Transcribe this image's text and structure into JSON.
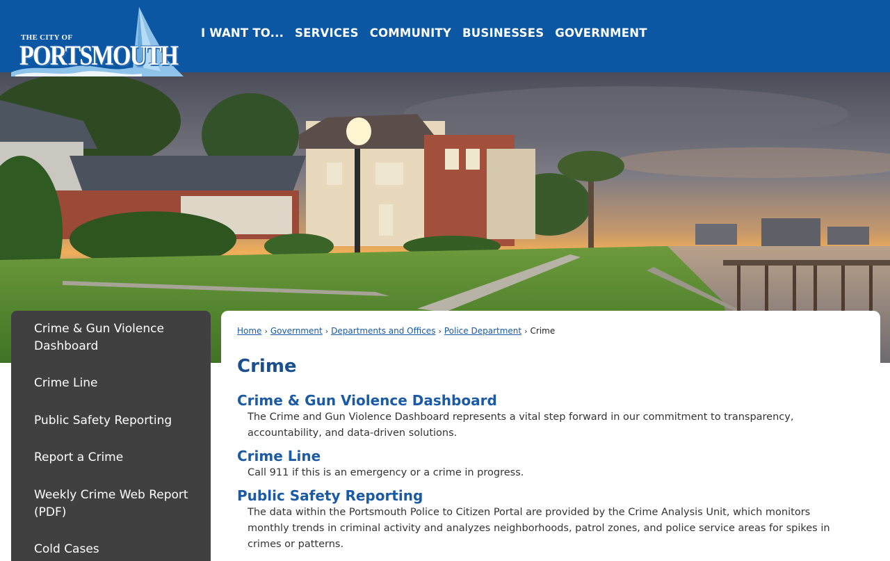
{
  "header": {
    "logo_top": "THE CITY OF",
    "logo_main": "PORTSMOUTH",
    "nav": [
      {
        "label": "I WANT TO..."
      },
      {
        "label": "SERVICES"
      },
      {
        "label": "COMMUNITY"
      },
      {
        "label": "BUSINESSES"
      },
      {
        "label": "GOVERNMENT"
      }
    ]
  },
  "sidebar": {
    "items": [
      {
        "label": "Crime & Gun Violence Dashboard"
      },
      {
        "label": "Crime Line"
      },
      {
        "label": "Public Safety Reporting"
      },
      {
        "label": "Report a Crime"
      },
      {
        "label": "Weekly Crime Web Report (PDF)"
      },
      {
        "label": "Cold Cases"
      }
    ]
  },
  "breadcrumb": {
    "items": [
      {
        "label": "Home"
      },
      {
        "label": " Government"
      },
      {
        "label": " Departments and Offices"
      },
      {
        "label": " Police Department"
      }
    ],
    "current": "Crime",
    "separator": "›"
  },
  "main": {
    "title": "Crime",
    "sections": [
      {
        "title": "Crime & Gun Violence Dashboard",
        "desc": "The Crime and Gun Violence Dashboard represents a vital step forward in our commitment to transparency, accountability, and data-driven solutions."
      },
      {
        "title": "Crime Line",
        "desc": "Call 911 if this is an emergency or a crime in progress."
      },
      {
        "title": "Public Safety Reporting",
        "desc": "The data within the Portsmouth Police to Citizen Portal are provided by the Crime Analysis Unit, which monitors monthly trends in criminal activity and analyzes neighborhoods, patrol zones, and police service areas for spikes in crimes or patterns."
      }
    ]
  },
  "colors": {
    "header_bg": "#0b57a4",
    "sidebar_bg": "#404040",
    "link": "#1a5aa3",
    "heading": "#1b4f8c"
  }
}
